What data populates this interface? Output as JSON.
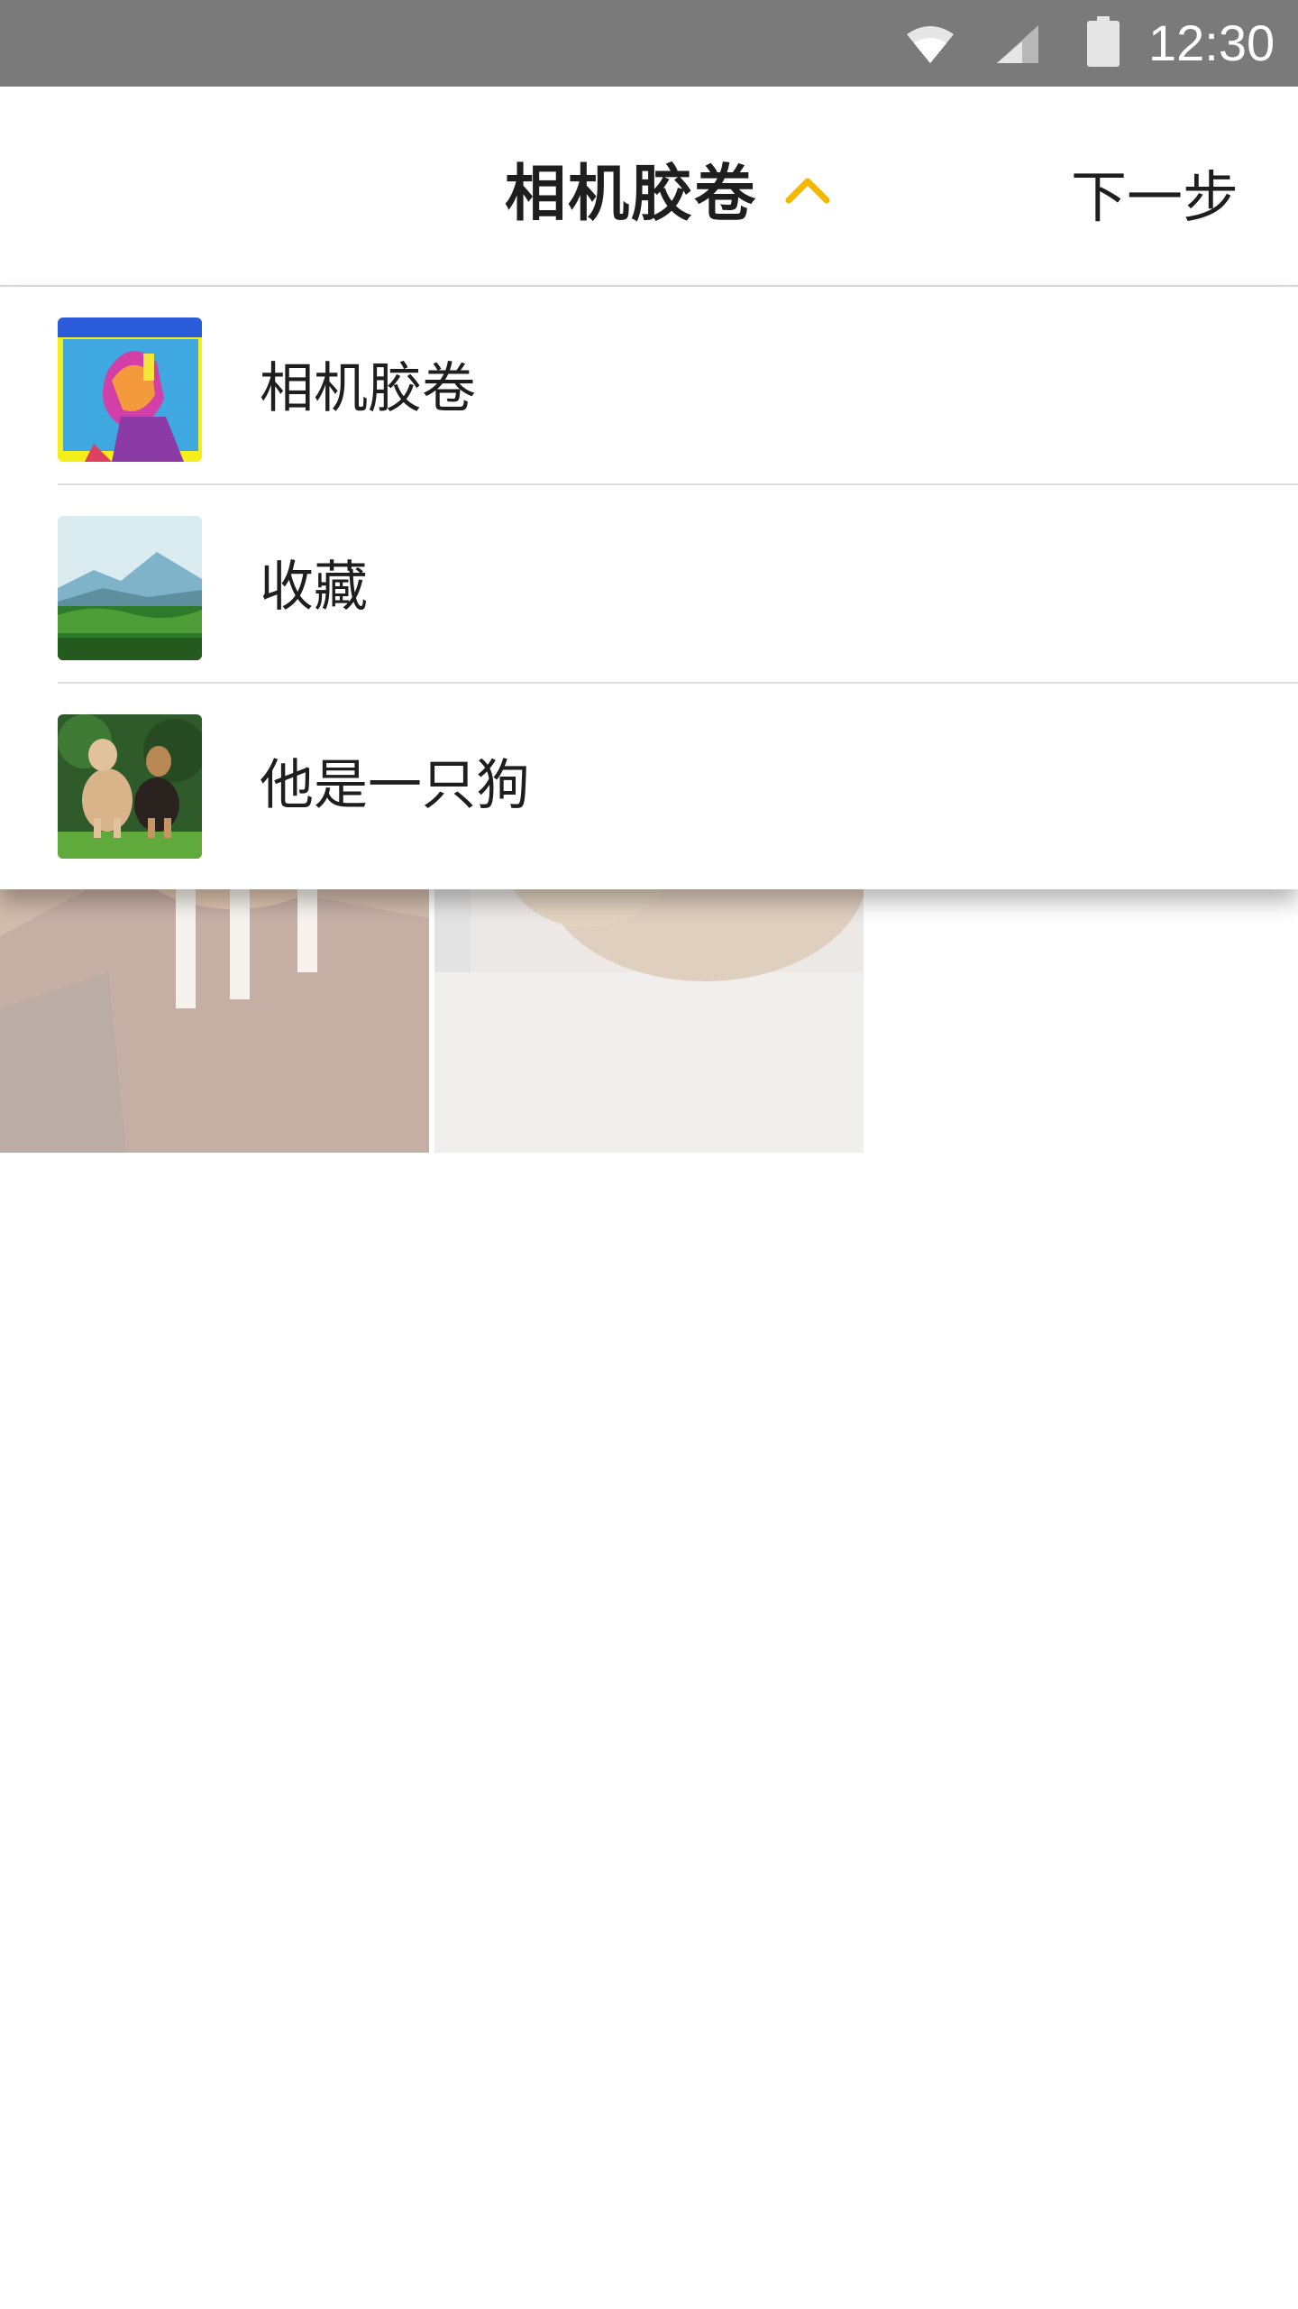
{
  "status_bar": {
    "time": "12:30",
    "icons": [
      "wifi-icon",
      "cell-signal-icon",
      "battery-icon"
    ]
  },
  "header": {
    "title": "相机胶卷",
    "next_label": "下一步",
    "expand_icon": "chevron-up-icon",
    "accent_color": "#f5b800"
  },
  "albums": [
    {
      "name": "相机胶卷",
      "thumbnail": "colorful-illustration-thumbnail"
    },
    {
      "name": "收藏",
      "thumbnail": "mountain-landscape-thumbnail"
    },
    {
      "name": "他是一只狗",
      "thumbnail": "two-dogs-thumbnail"
    }
  ],
  "grid": {
    "photos": [
      "puppy-on-rock-photo",
      "sleeping-cats-photo"
    ]
  }
}
